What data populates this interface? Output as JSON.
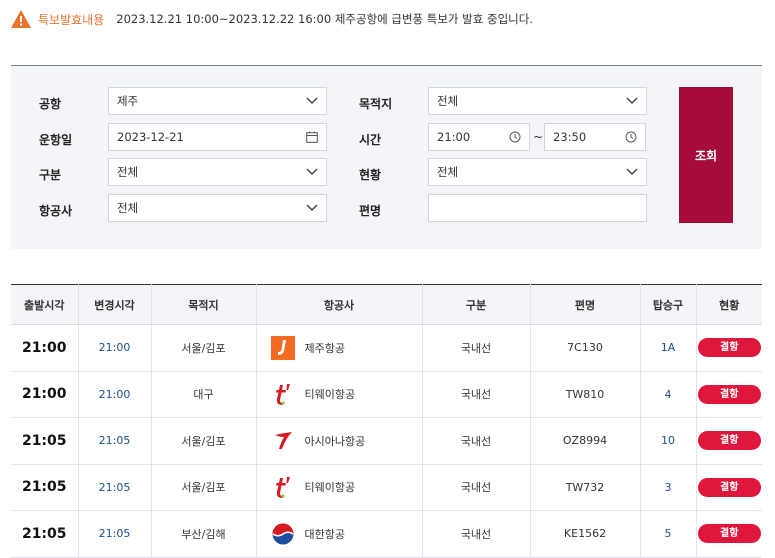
{
  "alert": {
    "label": "특보발효내용",
    "message": "2023.12.21 10:00~2023.12.22 16:00   제주공항에 급변풍 특보가 발효 중입니다."
  },
  "search": {
    "airport_label": "공항",
    "airport_value": "제주",
    "destination_label": "목적지",
    "destination_value": "전체",
    "date_label": "운항일",
    "date_value": "2023-12-21",
    "time_label": "시간",
    "time_from": "21:00",
    "time_sep": "~",
    "time_to": "23:50",
    "type_label": "구분",
    "type_value": "전체",
    "status_label": "현황",
    "status_value": "전체",
    "airline_label": "항공사",
    "airline_value": "전체",
    "flight_label": "편명",
    "flight_value": "",
    "submit": "조회"
  },
  "table": {
    "headers": [
      "출발시각",
      "변경시각",
      "목적지",
      "항공사",
      "구분",
      "편명",
      "탑승구",
      "현황"
    ],
    "rows": [
      {
        "dep": "21:00",
        "chg": "21:00",
        "dest": "서울/김포",
        "airline": "제주항공",
        "logo": "jejuair-logo",
        "type": "국내선",
        "flight": "7C130",
        "gate": "1A",
        "status": "결항"
      },
      {
        "dep": "21:00",
        "chg": "21:00",
        "dest": "대구",
        "airline": "티웨이항공",
        "logo": "tway-logo",
        "type": "국내선",
        "flight": "TW810",
        "gate": "4",
        "status": "결항"
      },
      {
        "dep": "21:05",
        "chg": "21:05",
        "dest": "서울/김포",
        "airline": "아시아나항공",
        "logo": "asiana-logo",
        "type": "국내선",
        "flight": "OZ8994",
        "gate": "10",
        "status": "결항"
      },
      {
        "dep": "21:05",
        "chg": "21:05",
        "dest": "서울/김포",
        "airline": "티웨이항공",
        "logo": "tway-logo",
        "type": "국내선",
        "flight": "TW732",
        "gate": "3",
        "status": "결항"
      },
      {
        "dep": "21:05",
        "chg": "21:05",
        "dest": "부산/김해",
        "airline": "대한항공",
        "logo": "koreanair-logo",
        "type": "국내선",
        "flight": "KE1562",
        "gate": "5",
        "status": "결항"
      }
    ]
  },
  "colors": {
    "alert_orange": "#e8732d",
    "search_button": "#a50c3a",
    "status_cancelled": "#e0173c",
    "link_blue": "#1f4e8c"
  }
}
